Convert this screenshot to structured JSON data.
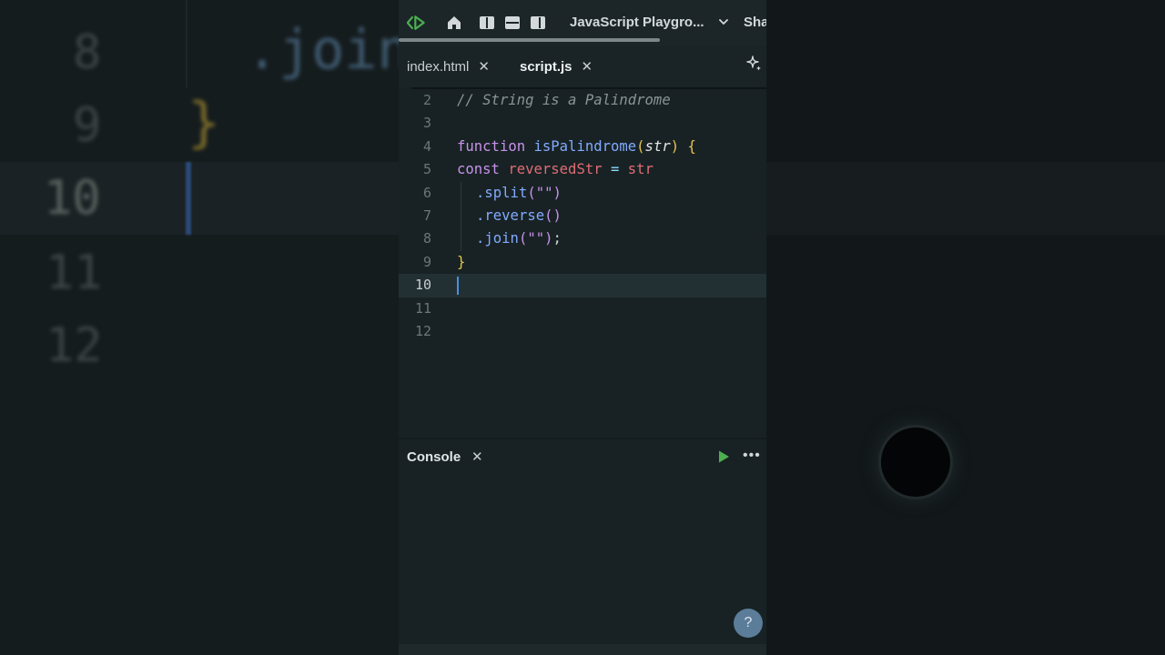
{
  "background_copy": {
    "line_numbers": [
      "8",
      "9",
      "10",
      "11",
      "12"
    ],
    "code_fragment": ".join",
    "brace": "}"
  },
  "topbar": {
    "project_title": "JavaScript Playgro...",
    "share_label": "Sha",
    "progress_fraction": 0.71
  },
  "tabs": [
    {
      "label": "index.html",
      "close": "✕",
      "active": false
    },
    {
      "label": "script.js",
      "close": "✕",
      "active": true
    }
  ],
  "editor": {
    "line_numbers": [
      "2",
      "3",
      "4",
      "5",
      "6",
      "7",
      "8",
      "9",
      "10",
      "11",
      "12"
    ],
    "active_line": "10",
    "code": {
      "comment": "// String is a Palindrome",
      "kw_function": "function",
      "fn_name": "isPalindrome",
      "open_paren": "(",
      "param": "str",
      "close_paren": ")",
      "open_brace": "{",
      "kw_const": "const",
      "var_name": "reversedStr",
      "op_eq": "=",
      "var_str": "str",
      "m_split": ".split",
      "m_reverse": ".reverse",
      "m_join": ".join",
      "split_args": "(\"\")",
      "reverse_args": "()",
      "join_args": "(\"\")",
      "semicolon": ";",
      "close_brace": "}"
    }
  },
  "console": {
    "title": "Console",
    "close": "✕",
    "more": "•••",
    "help": "?"
  },
  "colors": {
    "accent_green": "#4caf50",
    "caret_blue": "#4a90e2",
    "help_button": "#5b7d99"
  }
}
